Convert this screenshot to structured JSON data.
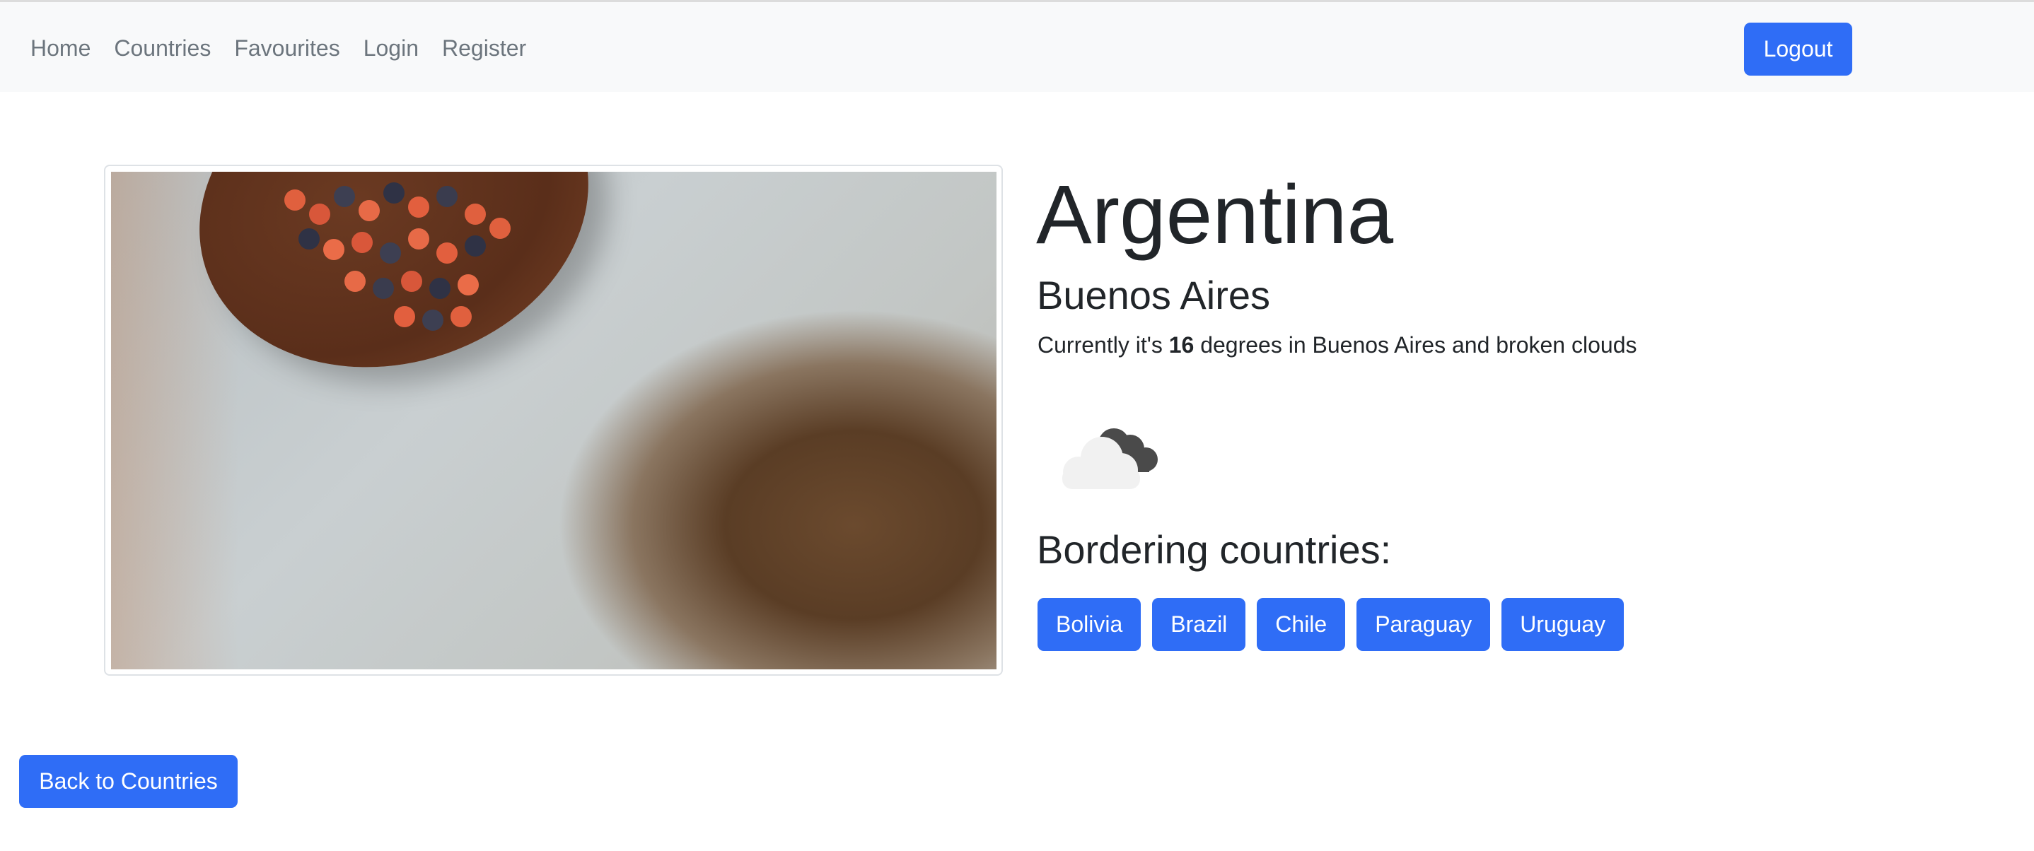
{
  "nav": {
    "links": [
      "Home",
      "Countries",
      "Favourites",
      "Login",
      "Register"
    ],
    "logout_label": "Logout"
  },
  "country": {
    "name": "Argentina",
    "capital": "Buenos Aires",
    "weather_prefix": "Currently it's ",
    "temperature": "16",
    "weather_suffix": " degrees in Buenos Aires and broken clouds",
    "weather_icon": "broken-clouds-icon"
  },
  "bordering": {
    "title": "Bordering countries:",
    "countries": [
      "Bolivia",
      "Brazil",
      "Chile",
      "Paraguay",
      "Uruguay"
    ]
  },
  "back_label": "Back to Countries",
  "colors": {
    "accent": "#2f6df6",
    "navbar_bg": "#f8f9fa",
    "nav_link": "#6c757d"
  }
}
